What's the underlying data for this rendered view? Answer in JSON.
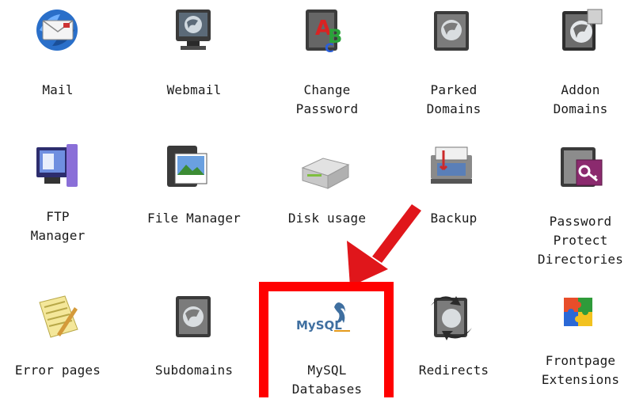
{
  "items": [
    {
      "id": "mail",
      "label": "Mail",
      "icon": "mail-icon"
    },
    {
      "id": "webmail",
      "label": "Webmail",
      "icon": "webmail-icon"
    },
    {
      "id": "change-password",
      "label": "Change\nPassword",
      "icon": "change-password-icon"
    },
    {
      "id": "parked-domains",
      "label": "Parked\nDomains",
      "icon": "parked-domains-icon"
    },
    {
      "id": "addon-domains",
      "label": "Addon\nDomains",
      "icon": "addon-domains-icon"
    },
    {
      "id": "ftp-manager",
      "label": "FTP\nManager",
      "icon": "ftp-manager-icon"
    },
    {
      "id": "file-manager",
      "label": "File Manager",
      "icon": "file-manager-icon"
    },
    {
      "id": "disk-usage",
      "label": "Disk usage",
      "icon": "disk-usage-icon"
    },
    {
      "id": "backup",
      "label": "Backup",
      "icon": "backup-icon"
    },
    {
      "id": "password-protect",
      "label": "Password\nProtect\nDirectories",
      "icon": "password-protect-icon"
    },
    {
      "id": "error-pages",
      "label": "Error pages",
      "icon": "error-pages-icon"
    },
    {
      "id": "subdomains",
      "label": "Subdomains",
      "icon": "subdomains-icon"
    },
    {
      "id": "mysql-databases",
      "label": "MySQL\nDatabases",
      "icon": "mysql-logo-icon"
    },
    {
      "id": "redirects",
      "label": "Redirects",
      "icon": "redirects-icon"
    },
    {
      "id": "frontpage-extensions",
      "label": "Frontpage\nExtensions",
      "icon": "frontpage-puzzle-icon"
    }
  ],
  "mysql_logo_text": "MySQL",
  "colors": {
    "highlight": "#ff0000",
    "arrow": "#e0161b",
    "mysql_blue": "#3f6fa0",
    "mysql_orange": "#e49a1c"
  }
}
